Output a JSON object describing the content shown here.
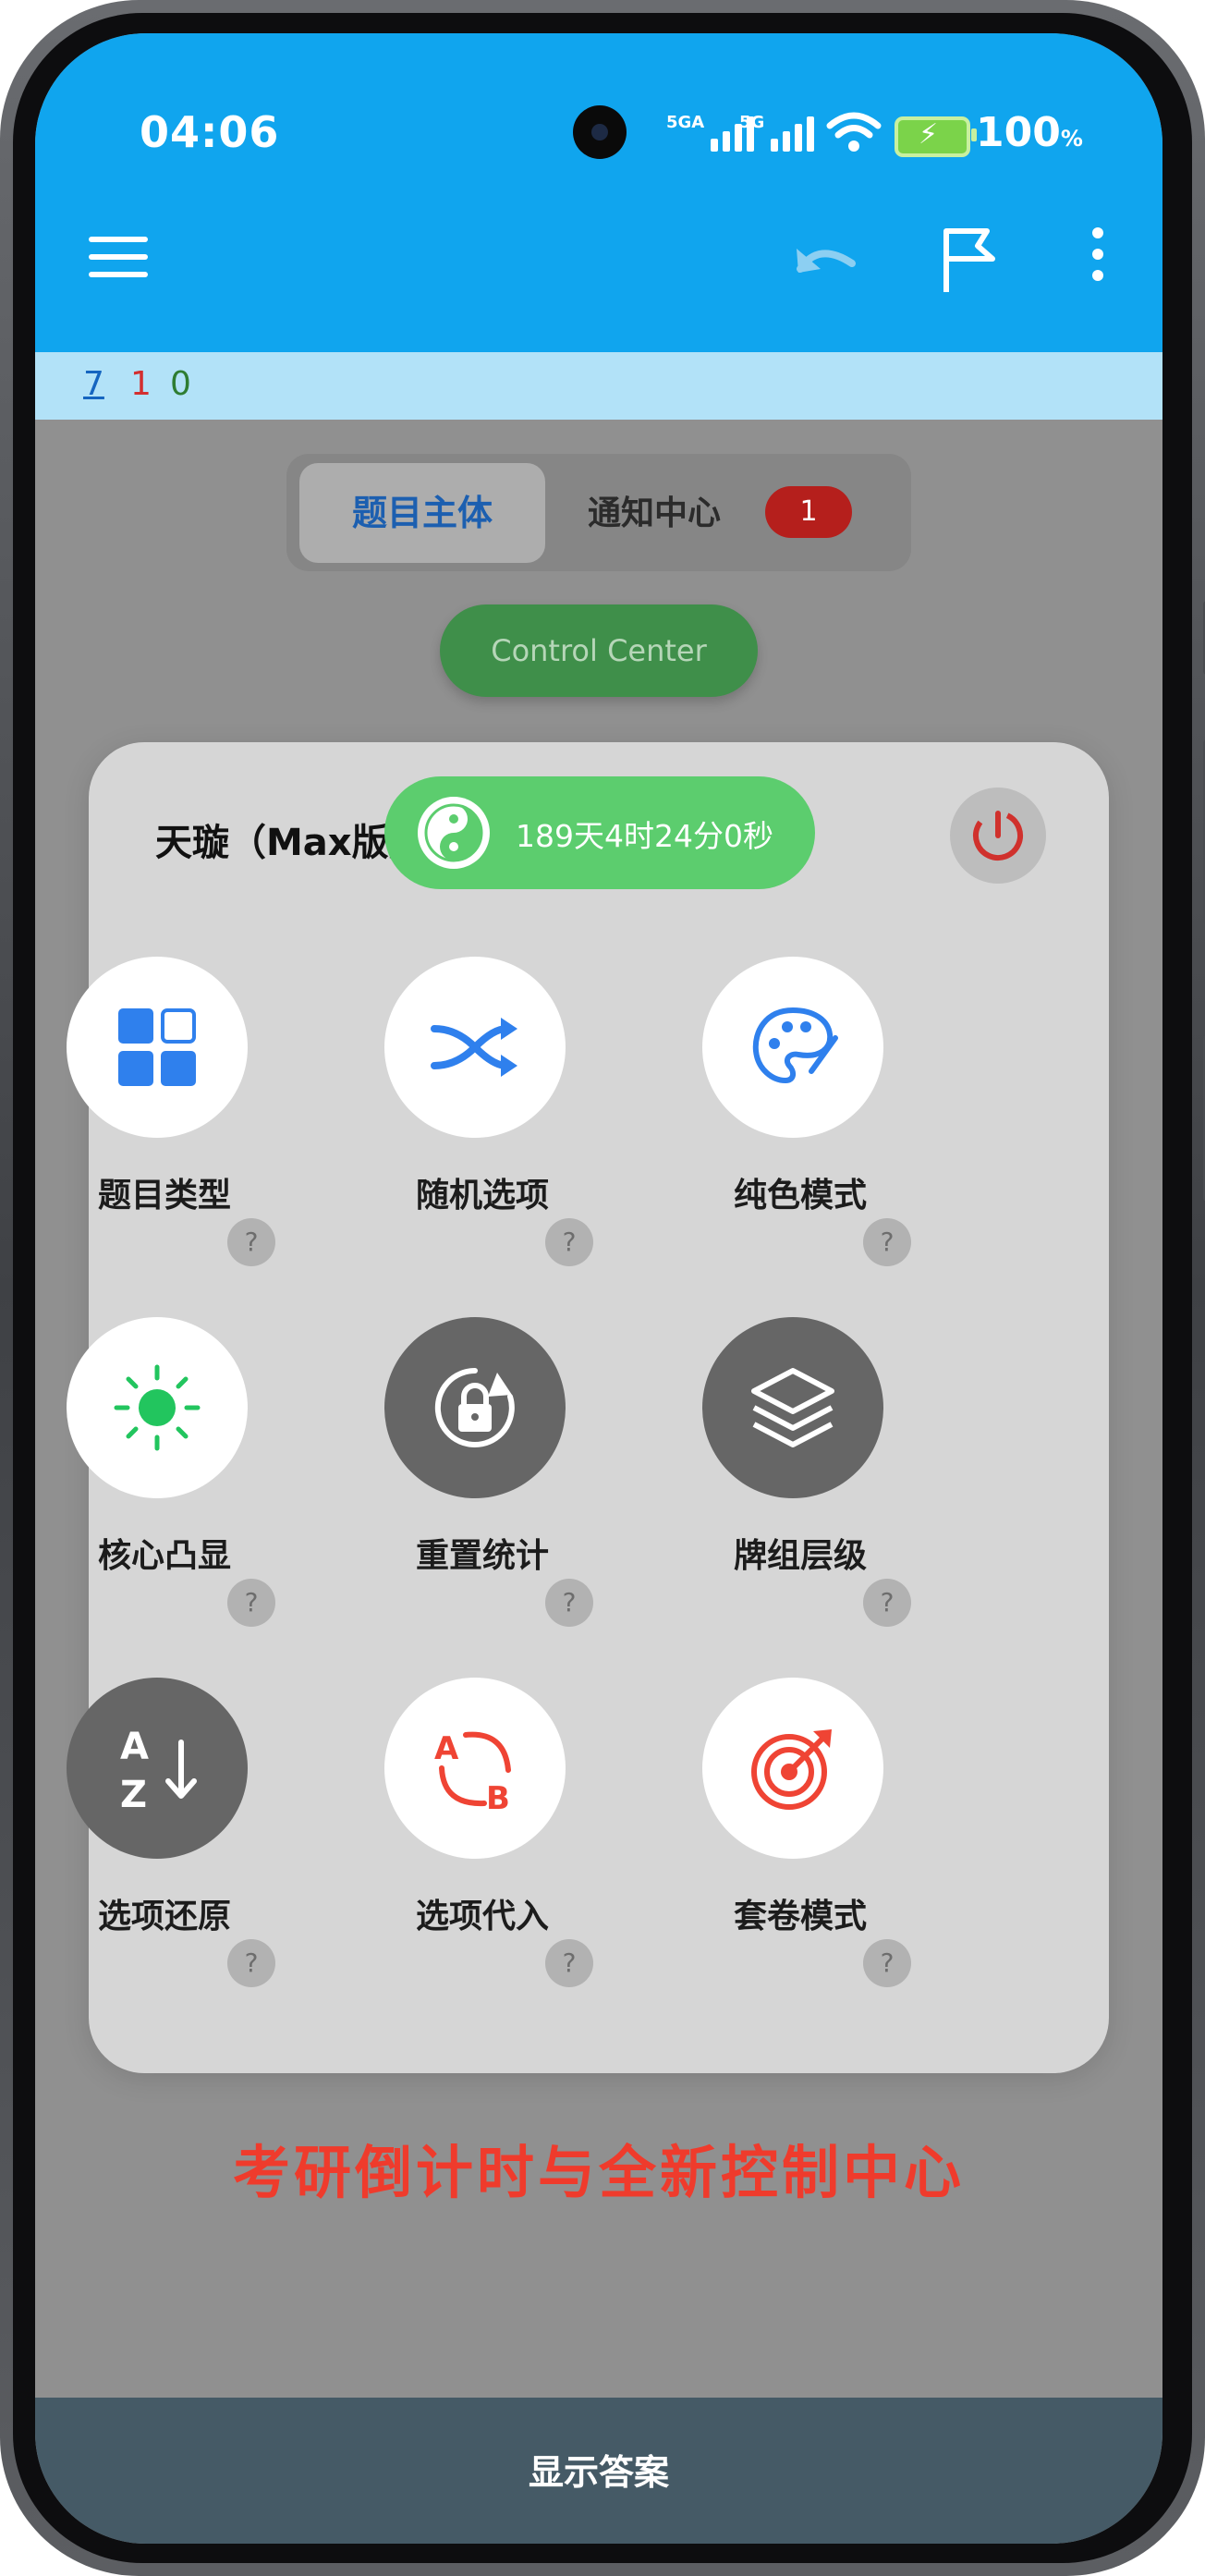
{
  "status_bar": {
    "time": "04:06",
    "signal1_label": "5GA",
    "signal2_label": "5G",
    "battery_percent": "100",
    "battery_unit": "%"
  },
  "app_bar": {
    "menu_icon": "menu-icon",
    "undo_icon": "undo-icon",
    "flag_icon": "flag-icon",
    "more_icon": "more-vert-icon"
  },
  "counters": {
    "blue": "7",
    "red": "1",
    "green": "0"
  },
  "tabs": {
    "subject": "题目主体",
    "notifications": "通知中心",
    "notification_count": "1"
  },
  "control_center_button": "Control Center",
  "panel": {
    "title": "天璇（Max版）",
    "countdown": "189天4时24分0秒",
    "tiles": [
      {
        "label": "题目类型",
        "help": "?",
        "icon": "grid-icon",
        "active": true
      },
      {
        "label": "随机选项",
        "help": "?",
        "icon": "shuffle-icon",
        "active": true
      },
      {
        "label": "纯色模式",
        "help": "?",
        "icon": "palette-icon",
        "active": true
      },
      {
        "label": "核心凸显",
        "help": "?",
        "icon": "sun-icon",
        "active": true
      },
      {
        "label": "重置统计",
        "help": "?",
        "icon": "lock-reset-icon",
        "active": false
      },
      {
        "label": "牌组层级",
        "help": "?",
        "icon": "layers-icon",
        "active": false
      },
      {
        "label": "选项还原",
        "help": "?",
        "icon": "sort-az-icon",
        "active": false
      },
      {
        "label": "选项代入",
        "help": "?",
        "icon": "swap-ab-icon",
        "active": true
      },
      {
        "label": "套卷模式",
        "help": "?",
        "icon": "target-icon",
        "active": true
      }
    ]
  },
  "promo_text": "考研倒计时与全新控制中心",
  "footer": {
    "show_answer": "显示答案"
  },
  "colors": {
    "primary": "#10a5ee",
    "counter_bar": "#b2e2f8",
    "accent_green": "#5ccd6e",
    "footer": "#455a66",
    "promo_red": "#ef3b2c",
    "icon_blue": "#2f80ed"
  }
}
